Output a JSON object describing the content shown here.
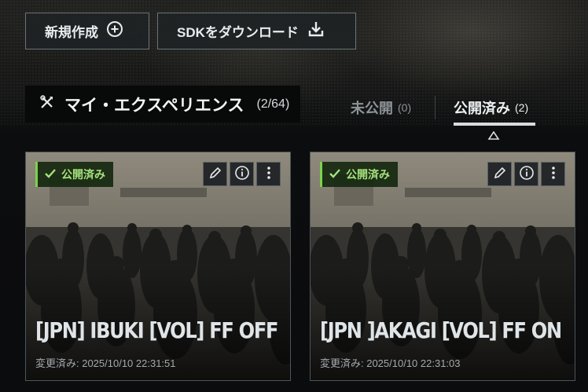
{
  "toolbar": {
    "new_label": "新規作成",
    "sdk_label": "SDKをダウンロード"
  },
  "section": {
    "title": "マイ・エクスペリエンス",
    "count": "(2/64)"
  },
  "tabs": [
    {
      "label": "未公開",
      "count": "(0)",
      "active": false
    },
    {
      "label": "公開済み",
      "count": "(2)",
      "active": true
    }
  ],
  "cards": [
    {
      "status": "公開済み",
      "title": "[JPN] IBUKI [VOL] FF OFF",
      "modified": "変更済み: 2025/10/10 22:31:51"
    },
    {
      "status": "公開済み",
      "title": "[JPN ]AKAGI [VOL] FF ON",
      "modified": "変更済み: 2025/10/10 22:31:03"
    }
  ],
  "colors": {
    "accent_green": "#7cd24b",
    "tab_active": "#eef1f2",
    "tab_inactive": "#8d9498"
  },
  "icons": [
    "plus-circle-icon",
    "download-icon",
    "tools-icon",
    "caret-up-icon",
    "check-icon",
    "pencil-icon",
    "info-icon",
    "more-vertical-icon"
  ]
}
